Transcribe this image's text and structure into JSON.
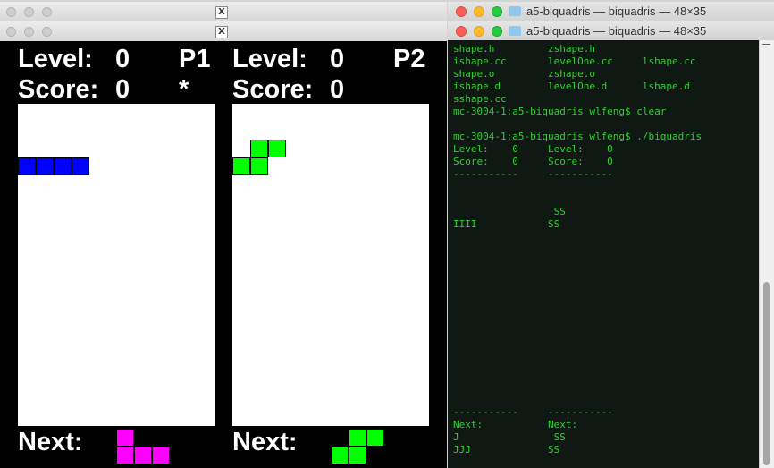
{
  "xwindow": {
    "icon": "X"
  },
  "game": {
    "p1": {
      "level_label": "Level:",
      "level": "0",
      "player": "P1",
      "score_label": "Score:",
      "score": "0",
      "turn_marker": "*",
      "next_label": "Next:"
    },
    "p2": {
      "level_label": "Level:",
      "level": "0",
      "player": "P2",
      "score_label": "Score:",
      "score": "0",
      "next_label": "Next:"
    },
    "colors": {
      "I": "#0000ff",
      "S": "#00ff00",
      "J": "#ff00ff"
    }
  },
  "terminal": {
    "title": "a5-biquadris — biquadris — 48×35",
    "lines": [
      "shape.h         zshape.h",
      "ishape.cc       levelOne.cc     lshape.cc",
      "shape.o         zshape.o",
      "ishape.d        levelOne.d      lshape.d",
      "sshape.cc",
      "mc-3004-1:a5-biquadris wlfeng$ clear",
      "",
      "mc-3004-1:a5-biquadris wlfeng$ ./biquadris",
      "Level:    0     Level:    0",
      "Score:    0     Score:    0",
      "-----------     -----------",
      "",
      "",
      "                 SS",
      "IIII            SS"
    ],
    "bottom_lines": [
      "-----------     -----------",
      "Next:           Next:",
      "J                SS",
      "JJJ             SS"
    ]
  }
}
